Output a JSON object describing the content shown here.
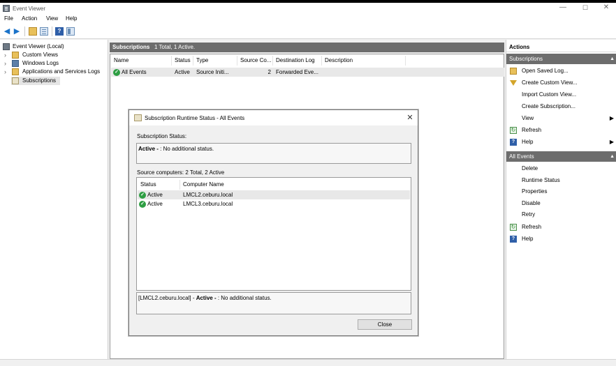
{
  "window": {
    "title": "Event Viewer",
    "controls": {
      "minimize": "—",
      "maximize": "☐",
      "close": "✕"
    }
  },
  "menu": [
    "File",
    "Action",
    "View",
    "Help"
  ],
  "tree": {
    "root": "Event Viewer (Local)",
    "items": [
      "Custom Views",
      "Windows Logs",
      "Applications and Services Logs",
      "Subscriptions"
    ],
    "selected": "Subscriptions"
  },
  "center": {
    "title": "Subscriptions",
    "count": "1 Total, 1 Active.",
    "columns": [
      "Name",
      "Status",
      "Type",
      "Source Co...",
      "Destination Log",
      "Description"
    ],
    "rows": [
      {
        "name": "All Events",
        "status": "Active",
        "type": "Source Initi...",
        "source_count": "2",
        "destination": "Forwarded Eve...",
        "description": ""
      }
    ]
  },
  "actions": {
    "header": "Actions",
    "groups": [
      {
        "title": "Subscriptions",
        "items": [
          {
            "label": "Open Saved Log...",
            "icon": "folder-open-icon",
            "submenu": false
          },
          {
            "label": "Create Custom View...",
            "icon": "filter-icon",
            "submenu": false
          },
          {
            "label": "Import Custom View...",
            "icon": "",
            "submenu": false
          },
          {
            "label": "Create Subscription...",
            "icon": "",
            "submenu": false
          },
          {
            "label": "View",
            "icon": "",
            "submenu": true
          },
          {
            "label": "Refresh",
            "icon": "refresh-icon",
            "submenu": false
          },
          {
            "label": "Help",
            "icon": "help-icon",
            "submenu": true
          }
        ]
      },
      {
        "title": "All Events",
        "items": [
          {
            "label": "Delete",
            "icon": "",
            "submenu": false
          },
          {
            "label": "Runtime Status",
            "icon": "",
            "submenu": false
          },
          {
            "label": "Properties",
            "icon": "",
            "submenu": false
          },
          {
            "label": "Disable",
            "icon": "",
            "submenu": false
          },
          {
            "label": "Retry",
            "icon": "",
            "submenu": false
          },
          {
            "label": "Refresh",
            "icon": "refresh-icon",
            "submenu": false
          },
          {
            "label": "Help",
            "icon": "help-icon",
            "submenu": false
          }
        ]
      }
    ]
  },
  "dialog": {
    "title": "Subscription Runtime Status - All Events",
    "status_label": "Subscription Status:",
    "status_bold": "Active - ",
    "status_text": ": No additional status.",
    "computers_label": "Source computers: 2 Total, 2 Active",
    "columns": [
      "Status",
      "Computer Name"
    ],
    "computers": [
      {
        "status": "Active",
        "name": "LMCL2.ceburu.local"
      },
      {
        "status": "Active",
        "name": "LMCL3.ceburu.local"
      }
    ],
    "detail_prefix": "[LMCL2.ceburu.local] - ",
    "detail_bold": "Active - ",
    "detail_text": ": No additional status.",
    "close_label": "Close"
  },
  "colors": {
    "accent": "#1b73c9",
    "header_gray": "#6d6d6d",
    "ok_green": "#2e9e43"
  }
}
